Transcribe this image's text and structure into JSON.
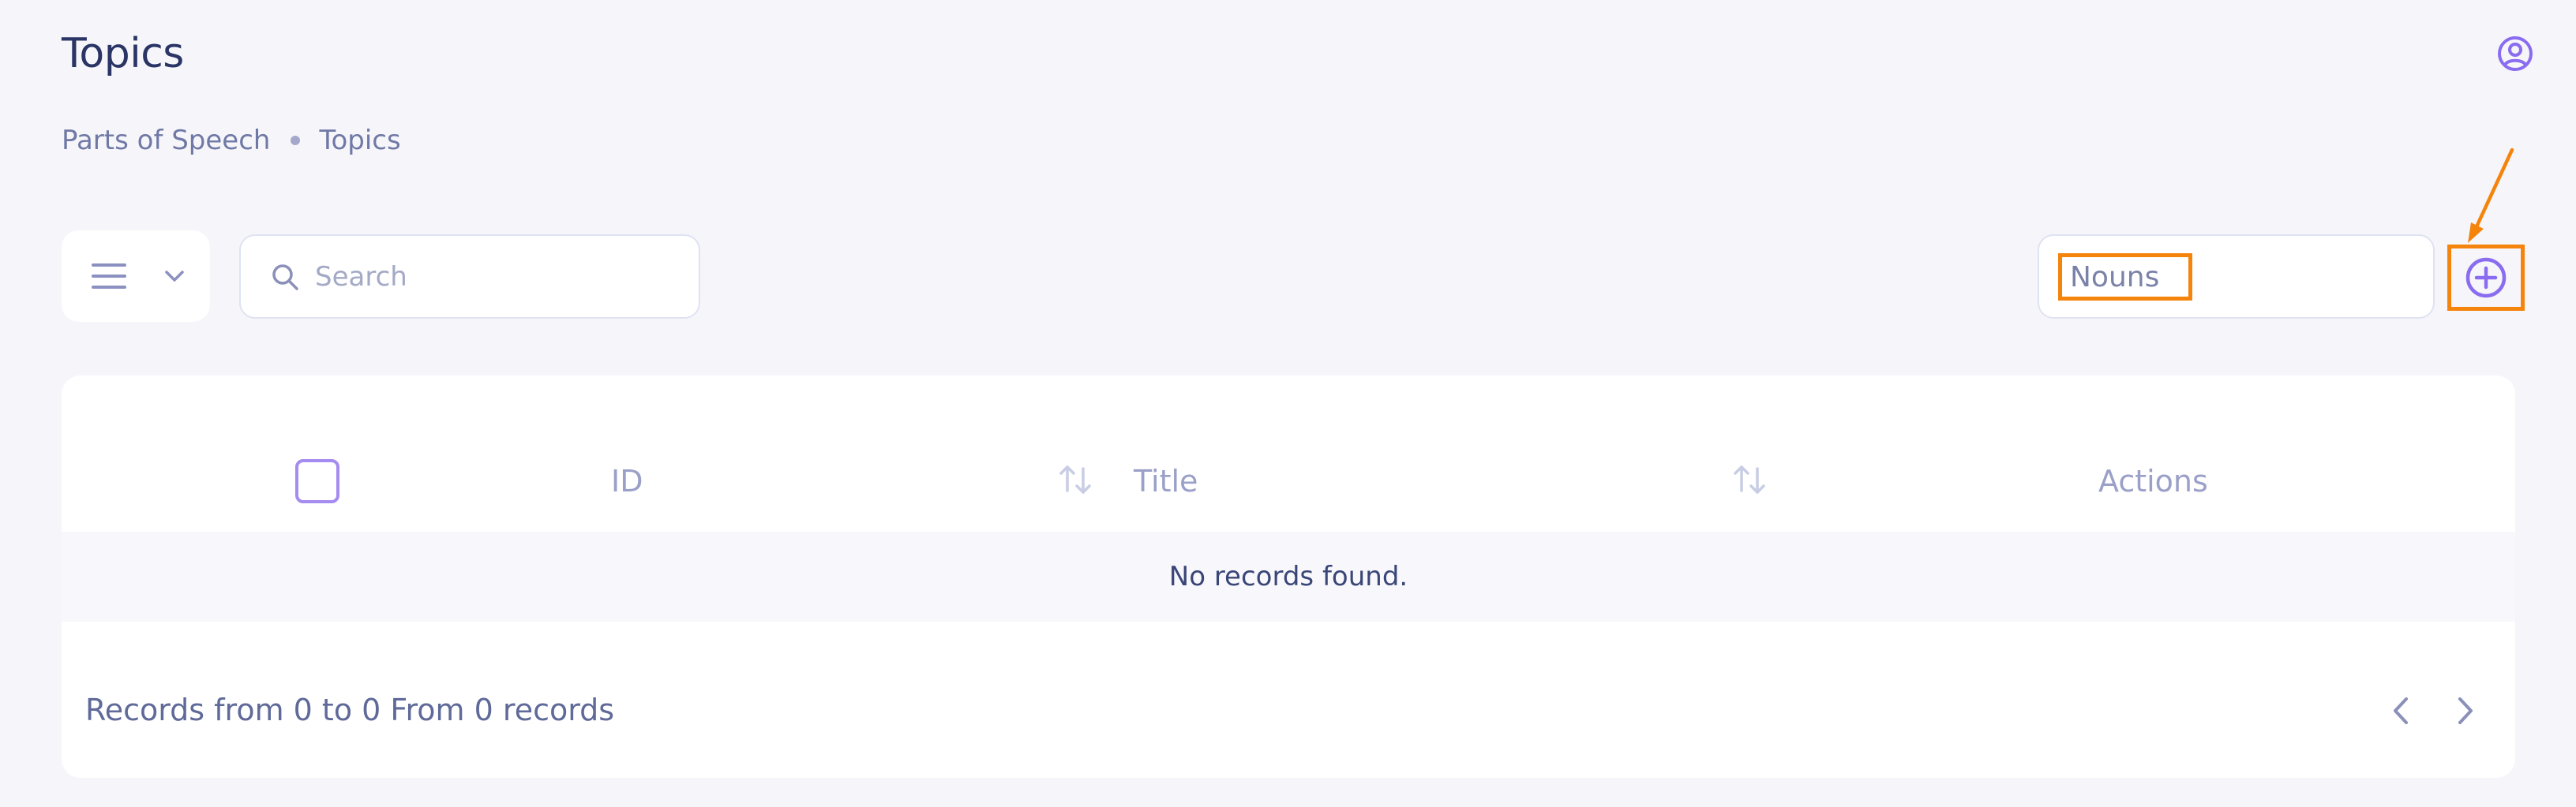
{
  "page": {
    "title": "Topics"
  },
  "breadcrumb": {
    "items": [
      "Parts of Speech",
      "Topics"
    ]
  },
  "toolbar": {
    "menu_icon": "hamburger-menu-icon",
    "dropdown_icon": "chevron-down-icon",
    "search_icon": "search-icon",
    "search_placeholder": "Search",
    "search_value": "",
    "topic_filter_value": "Nouns",
    "add_icon": "plus-circle-icon"
  },
  "table": {
    "columns": {
      "id": "ID",
      "title": "Title",
      "actions": "Actions"
    },
    "sort_icon": "sort-arrows-icon",
    "empty_message": "No records found.",
    "footer": "Records from 0 to 0 From 0 records",
    "prev_icon": "chevron-left-icon",
    "next_icon": "chevron-right-icon"
  },
  "header": {
    "user_icon": "user-circle-icon"
  },
  "colors": {
    "accent": "#8a6cf0",
    "highlight": "#f5840c",
    "background": "#f6f6fa",
    "text": "#3a4677"
  }
}
